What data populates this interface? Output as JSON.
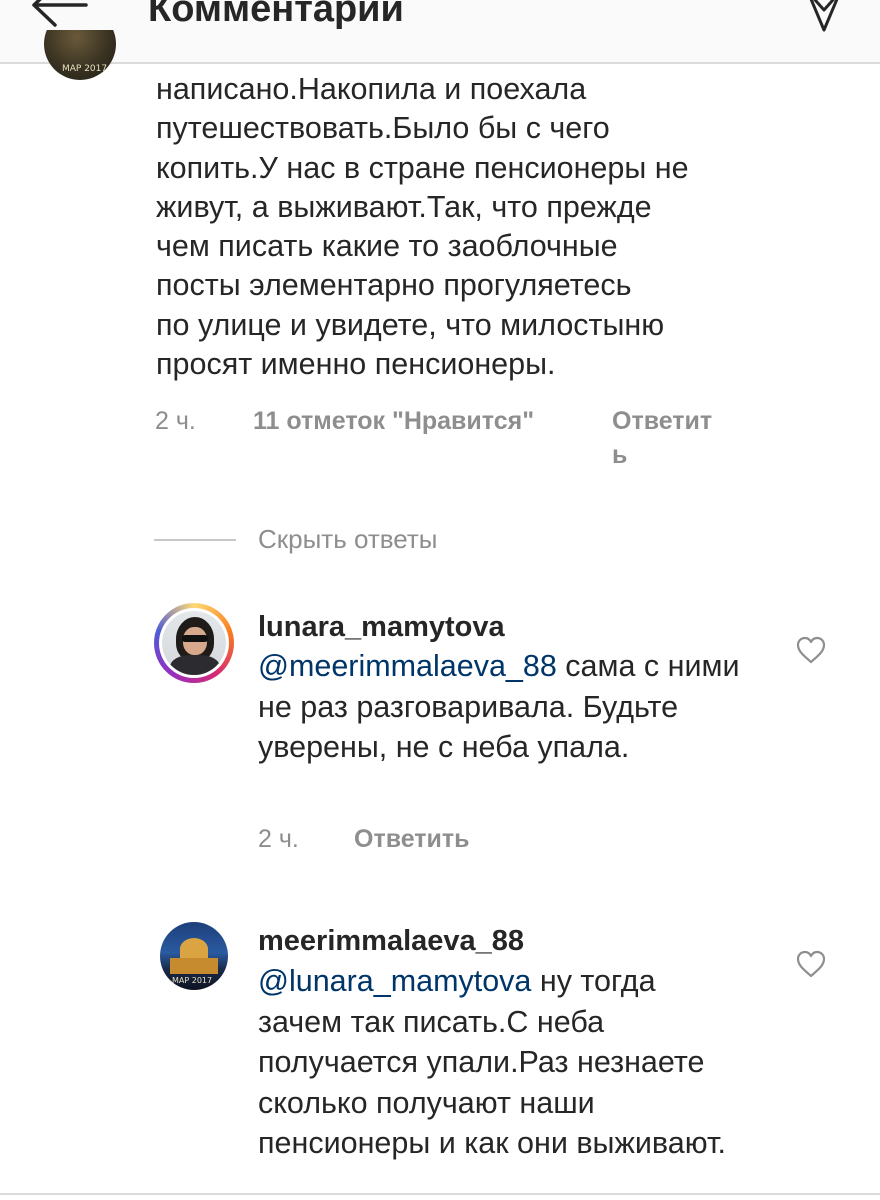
{
  "header": {
    "title": "Комментарии",
    "back_icon": "back-arrow-icon",
    "send_icon": "send-icon"
  },
  "main_comment": {
    "avatar_caption": "МАР 2017",
    "text": "написано.Накопила и поехала\nпутешествовать.Было бы с чего\nкопить.У нас в стране пенсионеры не\nживут, а выживают.Так, что  прежде\nчем писать  какие то заоблочные\nпосты элементарно прогуляетесь\nпо улице и увидете, что милостыню\nпросят именно пенсионеры.",
    "time": "2 ч.",
    "likes": "11 отметок \"Нравится\"",
    "reply": "Ответить"
  },
  "hide_replies": "Скрыть ответы",
  "replies": [
    {
      "username": "lunara_mamytova",
      "mention": "@meerimmalaeva_88",
      "text": " сама с ними не раз разговаривала. Будьте уверены, не с неба упала.",
      "time": "2 ч.",
      "reply": "Ответить"
    },
    {
      "username": "meerimmalaeva_88",
      "avatar_caption": "МАР 2017",
      "mention": "@lunara_mamytova",
      "text": " ну тогда зачем так писать.С неба получается упали.Раз незнаете сколько получают наши пенсионеры и как они выживают."
    }
  ],
  "colors": {
    "text": "#262626",
    "secondary": "#8e8e8e",
    "mention": "#003569",
    "header_bg": "#fafafa",
    "divider": "#dbdbdb"
  }
}
